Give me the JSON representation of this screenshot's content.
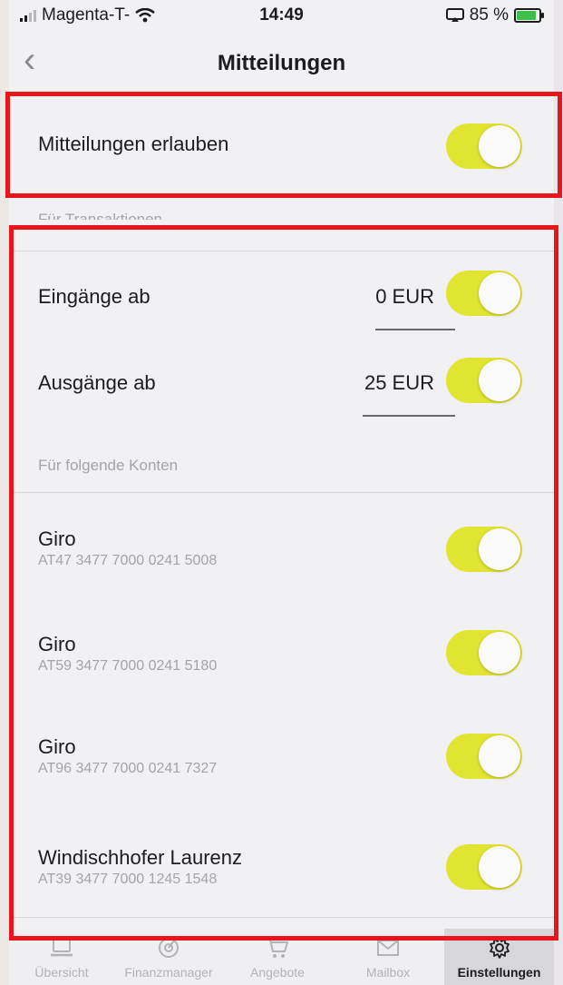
{
  "status": {
    "carrier": "Magenta-T-",
    "time": "14:49",
    "battery_text": "85 %"
  },
  "nav": {
    "back_icon": "chevron-left-icon",
    "title": "Mitteilungen"
  },
  "allow": {
    "label": "Mitteilungen erlauben",
    "enabled": true
  },
  "transactions": {
    "header": "Für Transaktionen",
    "incoming_label": "Eingänge ab",
    "incoming_amount": "0 EUR",
    "incoming_enabled": true,
    "outgoing_label": "Ausgänge ab",
    "outgoing_amount": "25 EUR",
    "outgoing_enabled": true
  },
  "accounts": {
    "header": "Für folgende Konten",
    "items": [
      {
        "name": "Giro",
        "iban": "AT47 3477 7000 0241 5008",
        "enabled": true
      },
      {
        "name": "Giro",
        "iban": "AT59 3477 7000 0241 5180",
        "enabled": true
      },
      {
        "name": "Giro",
        "iban": "AT96 3477 7000 0241 7327",
        "enabled": true
      },
      {
        "name": "Windischhofer Laurenz",
        "iban": "AT39 3477 7000 1245 1548",
        "enabled": true
      }
    ]
  },
  "tabs": [
    {
      "label": "Übersicht",
      "icon": "laptop-icon"
    },
    {
      "label": "Finanzmanager",
      "icon": "chart-circle-icon"
    },
    {
      "label": "Angebote",
      "icon": "cart-icon"
    },
    {
      "label": "Mailbox",
      "icon": "envelope-icon"
    },
    {
      "label": "Einstellungen",
      "icon": "gear-icon",
      "active": true
    }
  ],
  "colors": {
    "toggle_on": "#e2e432",
    "highlight": "#e8161b",
    "background": "#f1f0f3"
  }
}
